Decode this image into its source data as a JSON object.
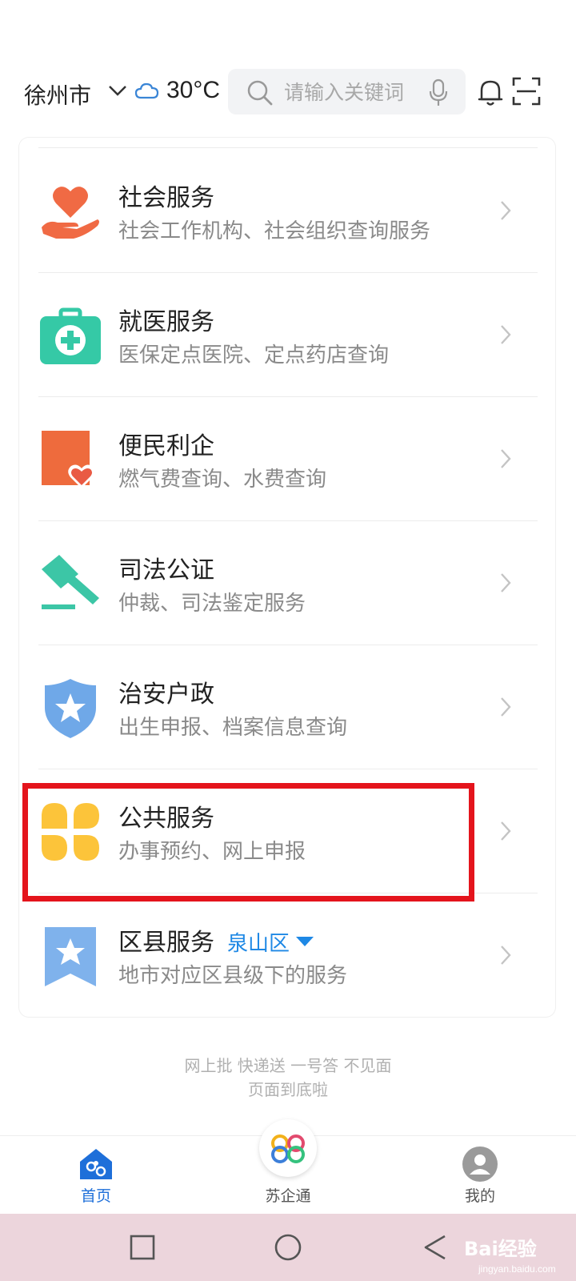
{
  "header": {
    "city": "徐州市",
    "temperature": "30°C",
    "search_placeholder": "请输入关键词"
  },
  "services": [
    {
      "title": "社会服务",
      "desc": "社会工作机构、社会组织查询服务",
      "icon": "heart-hand-icon"
    },
    {
      "title": "就医服务",
      "desc": "医保定点医院、定点药店查询",
      "icon": "medical-kit-icon"
    },
    {
      "title": "便民利企",
      "desc": "燃气费查询、水费查询",
      "icon": "convenience-heart-icon"
    },
    {
      "title": "司法公证",
      "desc": "仲裁、司法鉴定服务",
      "icon": "gavel-icon"
    },
    {
      "title": "治安户政",
      "desc": "出生申报、档案信息查询",
      "icon": "police-shield-icon"
    },
    {
      "title": "公共服务",
      "desc": "办事预约、网上申报",
      "icon": "clover-icon"
    },
    {
      "title": "区县服务",
      "district": "泉山区",
      "desc": "地市对应区县级下的服务",
      "icon": "star-bookmark-icon"
    }
  ],
  "footer": {
    "line1": "网上批 快递送 一号答 不见面",
    "line2": "页面到底啦"
  },
  "tabs": [
    {
      "label": "首页",
      "active": true
    },
    {
      "label": "苏企通",
      "active": false
    },
    {
      "label": "我的",
      "active": false
    }
  ],
  "watermark": {
    "text": "Bai经验",
    "sub": "jingyan.baidu.com"
  },
  "colors": {
    "accent_blue": "#1e6fd9",
    "highlight_red": "#e4141c",
    "nav_bar_bg": "#ecd5dc"
  }
}
